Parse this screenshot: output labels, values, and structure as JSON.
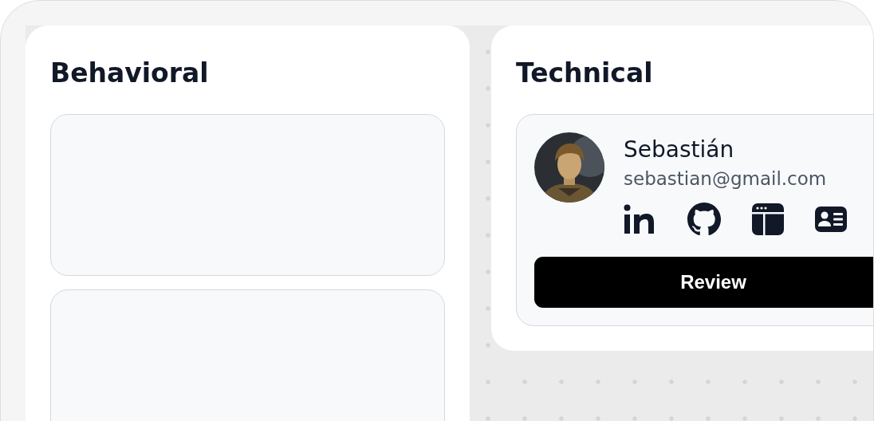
{
  "columns": [
    {
      "title": "Behavioral",
      "cards": [
        {
          "kind": "empty"
        },
        {
          "kind": "empty"
        }
      ]
    },
    {
      "title": "Technical",
      "cards": [
        {
          "kind": "candidate",
          "name": "Sebastián",
          "email": "sebastian@gmail.com",
          "links": [
            {
              "kind": "linkedin"
            },
            {
              "kind": "github"
            },
            {
              "kind": "website"
            },
            {
              "kind": "resume"
            }
          ],
          "button": "Review"
        }
      ]
    }
  ]
}
